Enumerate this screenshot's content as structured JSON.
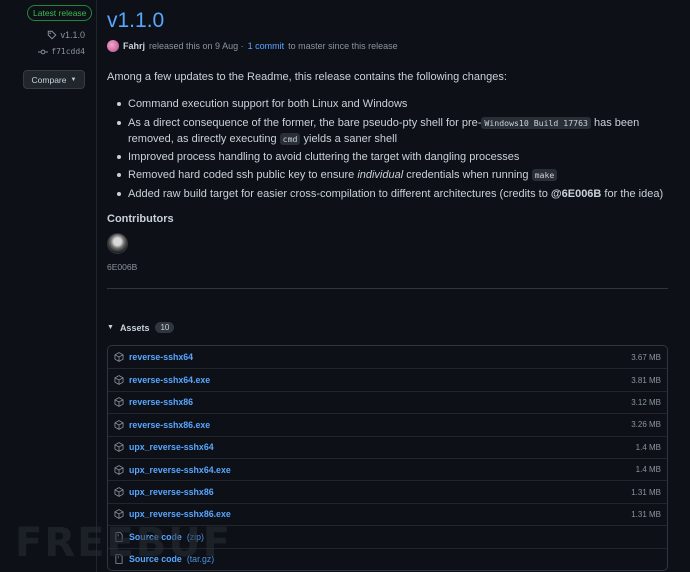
{
  "sidebar": {
    "latest_badge": "Latest release",
    "tag": "v1.1.0",
    "commit": "f71cdd4",
    "compare_label": "Compare"
  },
  "release": {
    "title": "v1.1.0",
    "author": "Fahrj",
    "released_text": "released this on 9 Aug ·",
    "commit_link": "1 commit",
    "since_text": "to master since this release"
  },
  "body": {
    "intro": "Among a few updates to the Readme, this release contains the following changes:",
    "items": [
      {
        "text": "Command execution support for both Linux and Windows"
      },
      {
        "a": "As a direct consequence of the former, the bare pseudo-pty shell for pre-",
        "code1": "Windows10 Build 17763",
        "b": " has been removed, as directly executing ",
        "code2": "cmd",
        "c": " yields a saner shell"
      },
      {
        "text": "Improved process handling to avoid cluttering the target with dangling processes"
      },
      {
        "a": "Removed hard coded ssh public key to ensure ",
        "em": "individual",
        "b": " credentials when running ",
        "code": "make"
      },
      {
        "a": "Added raw build target for easier cross-compilation to different architectures (credits to ",
        "strong": "@6E006B",
        "b": " for the idea)"
      }
    ]
  },
  "contributors": {
    "title": "Contributors",
    "name": "6E006B"
  },
  "assets": {
    "title": "Assets",
    "count": "10",
    "files": [
      {
        "name": "reverse-sshx64",
        "size": "3.67 MB"
      },
      {
        "name": "reverse-sshx64.exe",
        "size": "3.81 MB"
      },
      {
        "name": "reverse-sshx86",
        "size": "3.12 MB"
      },
      {
        "name": "reverse-sshx86.exe",
        "size": "3.26 MB"
      },
      {
        "name": "upx_reverse-sshx64",
        "size": "1.4 MB"
      },
      {
        "name": "upx_reverse-sshx64.exe",
        "size": "1.4 MB"
      },
      {
        "name": "upx_reverse-sshx86",
        "size": "1.31 MB"
      },
      {
        "name": "upx_reverse-sshx86.exe",
        "size": "1.31 MB"
      }
    ],
    "source": [
      {
        "name": "Source code",
        "ext": "(zip)"
      },
      {
        "name": "Source code",
        "ext": "(tar.gz)"
      }
    ]
  },
  "watermark": "FREEBUF",
  "colors": {
    "accent": "#58a6ff",
    "success": "#3fb950",
    "background": "#0d1117"
  }
}
